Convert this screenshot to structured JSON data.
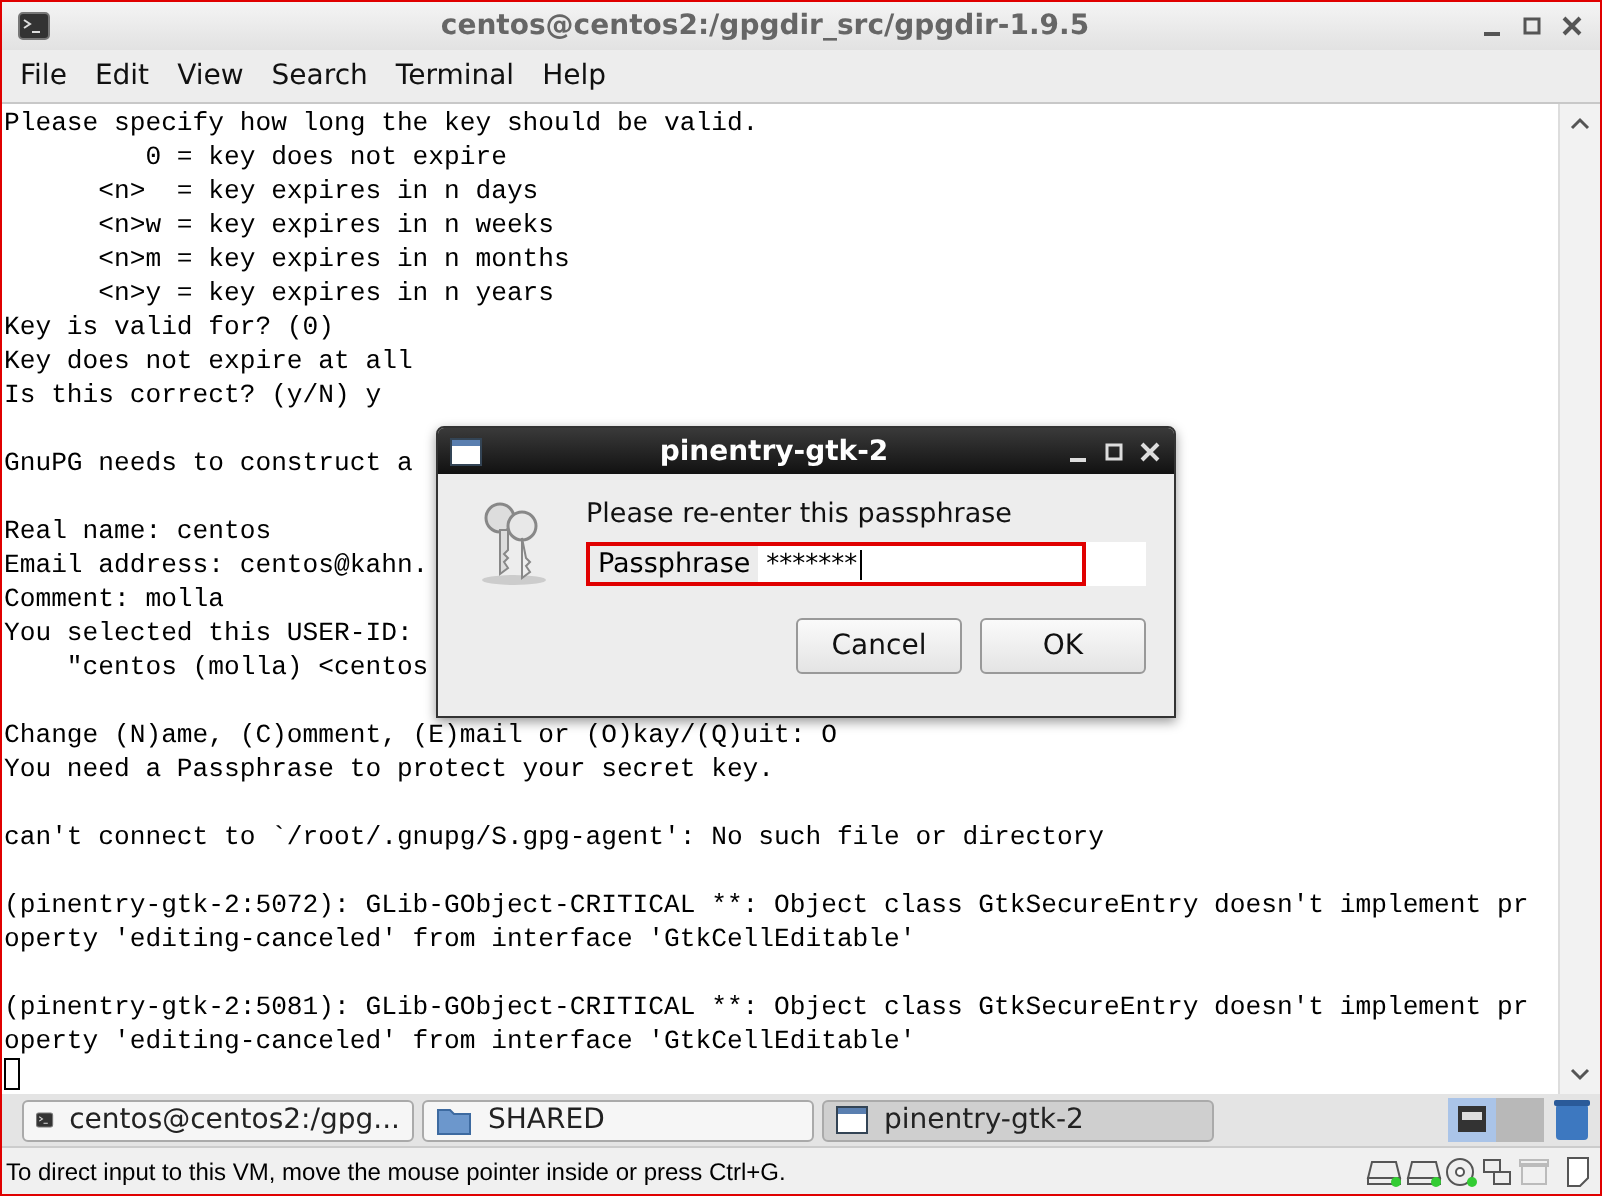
{
  "window": {
    "title": "centos@centos2:/gpgdir_src/gpgdir-1.9.5"
  },
  "menu": [
    "File",
    "Edit",
    "View",
    "Search",
    "Terminal",
    "Help"
  ],
  "terminal": {
    "paragraphs": [
      [
        "Please specify how long the key should be valid.",
        "         0 = key does not expire",
        "      <n>  = key expires in n days",
        "      <n>w = key expires in n weeks",
        "      <n>m = key expires in n months",
        "      <n>y = key expires in n years",
        "Key is valid for? (0)",
        "Key does not expire at all",
        "Is this correct? (y/N) y"
      ],
      [
        "GnuPG needs to construct a"
      ],
      [
        "Real name: centos",
        "Email address: centos@kahn.",
        "Comment: molla",
        "You selected this USER-ID:",
        "    \"centos (molla) <centos"
      ],
      [
        "Change (N)ame, (C)omment, (E)mail or (O)kay/(Q)uit: O",
        "You need a Passphrase to protect your secret key."
      ],
      [
        "can't connect to `/root/.gnupg/S.gpg-agent': No such file or directory"
      ],
      [
        "(pinentry-gtk-2:5072): GLib-GObject-CRITICAL **: Object class GtkSecureEntry doesn't implement pr",
        "operty 'editing-canceled' from interface 'GtkCellEditable'"
      ],
      [
        "(pinentry-gtk-2:5081): GLib-GObject-CRITICAL **: Object class GtkSecureEntry doesn't implement pr",
        "operty 'editing-canceled' from interface 'GtkCellEditable'"
      ]
    ]
  },
  "dialog": {
    "title": "pinentry-gtk-2",
    "prompt": "Please re-enter this passphrase",
    "field_label": "Passphrase",
    "value": "*******",
    "buttons": [
      "Cancel",
      "OK"
    ]
  },
  "taskbar": [
    {
      "label": "centos@centos2:/gpg...",
      "kind": "terminal",
      "selected": false
    },
    {
      "label": "SHARED",
      "kind": "folder",
      "selected": false
    },
    {
      "label": "pinentry-gtk-2",
      "kind": "window",
      "selected": true
    }
  ],
  "status_bar": {
    "message": "To direct input to this VM, move the mouse pointer inside or press Ctrl+G."
  }
}
